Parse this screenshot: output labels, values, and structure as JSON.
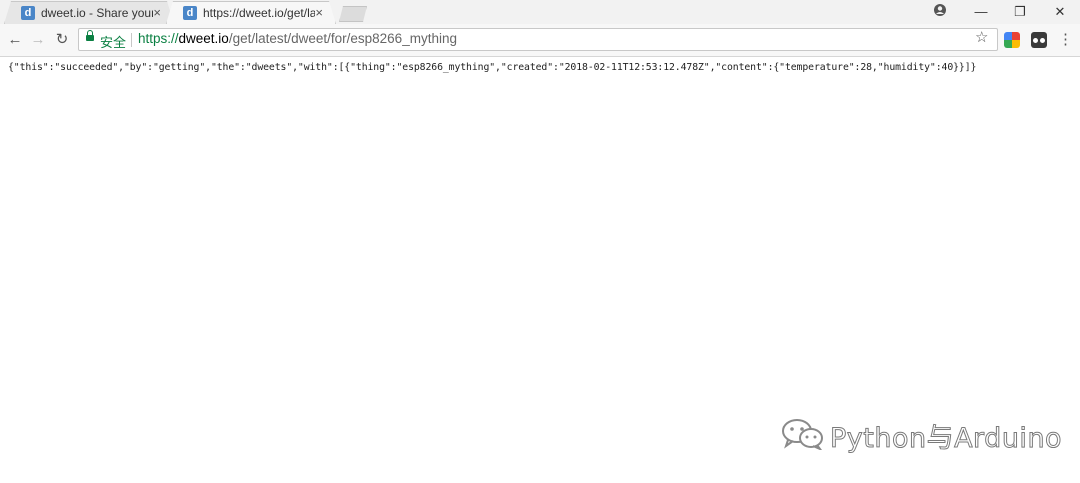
{
  "tabs": [
    {
      "favicon": "d",
      "title": "dweet.io - Share your t",
      "close": "×"
    },
    {
      "favicon": "d",
      "title": "https://dweet.io/get/la",
      "close": "×"
    }
  ],
  "window_controls": {
    "minimize": "—",
    "restore": "❐",
    "close": "✕"
  },
  "toolbar": {
    "back": "←",
    "forward": "→",
    "reload": "↻",
    "secure_label": "安全",
    "url": {
      "scheme": "https://",
      "host": "dweet.io",
      "path": "/get/latest/dweet/for/esp8266_mything"
    },
    "star": "☆",
    "menu": "⋮"
  },
  "content": {
    "json_text": "{\"this\":\"succeeded\",\"by\":\"getting\",\"the\":\"dweets\",\"with\":[{\"thing\":\"esp8266_mything\",\"created\":\"2018-02-11T12:53:12.478Z\",\"content\":{\"temperature\":28,\"humidity\":40}}]}"
  },
  "watermark": {
    "text": "Python与Arduino",
    "icon": "wechat-icon"
  },
  "colors": {
    "secure_green": "#0b8043",
    "favicon_blue": "#4a86c8"
  }
}
